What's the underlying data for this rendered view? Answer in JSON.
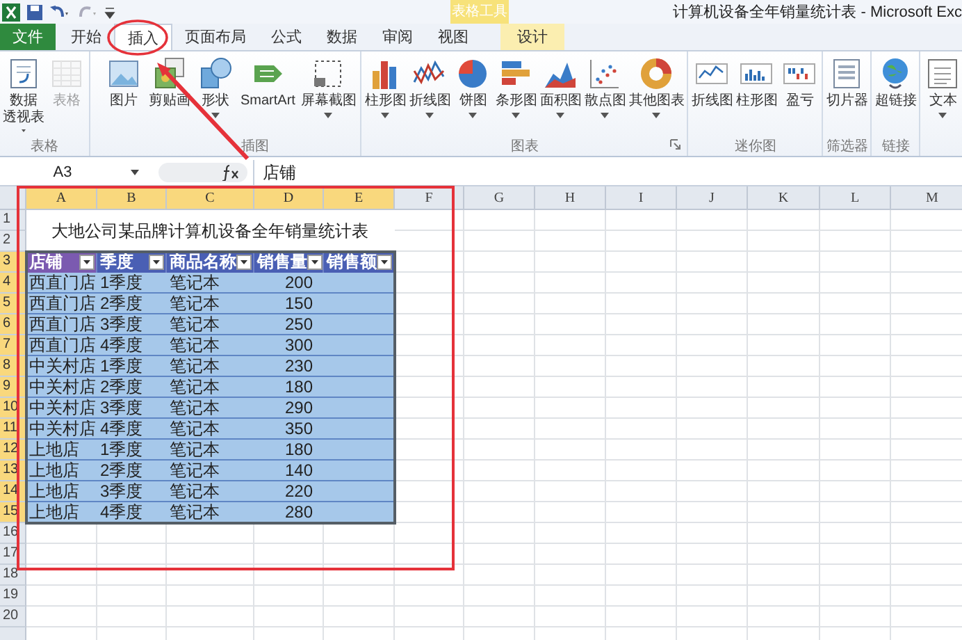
{
  "title_bar": {
    "title": "计算机设备全年销量统计表 - Microsoft Exc",
    "contextual_group": "表格工具"
  },
  "tabs": [
    {
      "label": "文件",
      "kind": "file",
      "selected": false
    },
    {
      "label": "开始",
      "kind": "main",
      "selected": false
    },
    {
      "label": "插入",
      "kind": "main",
      "selected": true
    },
    {
      "label": "页面布局",
      "kind": "main",
      "selected": false
    },
    {
      "label": "公式",
      "kind": "main",
      "selected": false
    },
    {
      "label": "数据",
      "kind": "main",
      "selected": false
    },
    {
      "label": "审阅",
      "kind": "main",
      "selected": false
    },
    {
      "label": "视图",
      "kind": "main",
      "selected": false
    },
    {
      "label": "设计",
      "kind": "contextual",
      "selected": false
    }
  ],
  "ribbon": {
    "groups": [
      {
        "label": "表格",
        "launcher": false,
        "buttons": [
          {
            "lines": [
              "数据",
              "透视表"
            ],
            "dropdown": true,
            "disabled": false
          },
          {
            "label": "表格",
            "dropdown": false,
            "disabled": true
          }
        ]
      },
      {
        "label": "插图",
        "launcher": false,
        "buttons": [
          {
            "label": "图片",
            "dropdown": false,
            "disabled": false
          },
          {
            "label": "剪贴画",
            "dropdown": false,
            "disabled": false
          },
          {
            "label": "形状",
            "dropdown": true,
            "disabled": false
          },
          {
            "label": "SmartArt",
            "dropdown": false,
            "disabled": false
          },
          {
            "label": "屏幕截图",
            "dropdown": true,
            "disabled": false
          }
        ]
      },
      {
        "label": "图表",
        "launcher": true,
        "buttons": [
          {
            "label": "柱形图",
            "dropdown": true,
            "disabled": false
          },
          {
            "label": "折线图",
            "dropdown": true,
            "disabled": false
          },
          {
            "label": "饼图",
            "dropdown": true,
            "disabled": false
          },
          {
            "label": "条形图",
            "dropdown": true,
            "disabled": false
          },
          {
            "label": "面积图",
            "dropdown": true,
            "disabled": false
          },
          {
            "label": "散点图",
            "dropdown": true,
            "disabled": false
          },
          {
            "label": "其他图表",
            "dropdown": true,
            "disabled": false
          }
        ]
      },
      {
        "label": "迷你图",
        "launcher": false,
        "buttons": [
          {
            "label": "折线图",
            "dropdown": false,
            "disabled": false
          },
          {
            "label": "柱形图",
            "dropdown": false,
            "disabled": false
          },
          {
            "label": "盈亏",
            "dropdown": false,
            "disabled": false
          }
        ]
      },
      {
        "label": "筛选器",
        "launcher": false,
        "buttons": [
          {
            "label": "切片器",
            "dropdown": false,
            "disabled": false
          }
        ]
      },
      {
        "label": "链接",
        "launcher": false,
        "buttons": [
          {
            "label": "超链接",
            "dropdown": false,
            "disabled": false
          }
        ]
      },
      {
        "buttons": [
          {
            "label": "文本",
            "dropdown": true,
            "disabled": false
          }
        ]
      }
    ]
  },
  "formula_bar": {
    "name_box": "A3",
    "value": "店铺"
  },
  "sheet": {
    "columns": [
      {
        "label": "A",
        "selected": true
      },
      {
        "label": "B",
        "selected": true
      },
      {
        "label": "C",
        "selected": true
      },
      {
        "label": "D",
        "selected": true
      },
      {
        "label": "E",
        "selected": true
      },
      {
        "label": "F",
        "selected": false
      },
      {
        "label": "G",
        "selected": false
      },
      {
        "label": "H",
        "selected": false
      },
      {
        "label": "I",
        "selected": false
      },
      {
        "label": "J",
        "selected": false
      },
      {
        "label": "K",
        "selected": false
      },
      {
        "label": "L",
        "selected": false
      },
      {
        "label": "M",
        "selected": false
      }
    ],
    "rows": [
      {
        "label": "1",
        "selected": false
      },
      {
        "label": "2",
        "selected": false
      },
      {
        "label": "3",
        "selected": true
      },
      {
        "label": "4",
        "selected": true
      },
      {
        "label": "5",
        "selected": true
      },
      {
        "label": "6",
        "selected": true
      },
      {
        "label": "7",
        "selected": true
      },
      {
        "label": "8",
        "selected": true
      },
      {
        "label": "9",
        "selected": true
      },
      {
        "label": "10",
        "selected": true
      },
      {
        "label": "11",
        "selected": true
      },
      {
        "label": "12",
        "selected": true
      },
      {
        "label": "13",
        "selected": true
      },
      {
        "label": "14",
        "selected": true
      },
      {
        "label": "15",
        "selected": true
      },
      {
        "label": "16",
        "selected": false
      },
      {
        "label": "17",
        "selected": false
      },
      {
        "label": "18",
        "selected": false
      },
      {
        "label": "19",
        "selected": false
      },
      {
        "label": "20",
        "selected": false
      }
    ],
    "title": "大地公司某品牌计算机设备全年销量统计表",
    "table": {
      "headers": [
        {
          "label": "店铺",
          "selected": true
        },
        {
          "label": "季度",
          "selected": false
        },
        {
          "label": "商品名称",
          "selected": false
        },
        {
          "label": "销售量",
          "selected": false
        },
        {
          "label": "销售额",
          "selected": false
        }
      ],
      "rows": [
        [
          "西直门店",
          "1季度",
          "笔记本",
          "200"
        ],
        [
          "西直门店",
          "2季度",
          "笔记本",
          "150"
        ],
        [
          "西直门店",
          "3季度",
          "笔记本",
          "250"
        ],
        [
          "西直门店",
          "4季度",
          "笔记本",
          "300"
        ],
        [
          "中关村店",
          "1季度",
          "笔记本",
          "230"
        ],
        [
          "中关村店",
          "2季度",
          "笔记本",
          "180"
        ],
        [
          "中关村店",
          "3季度",
          "笔记本",
          "290"
        ],
        [
          "中关村店",
          "4季度",
          "笔记本",
          "350"
        ],
        [
          "上地店",
          "1季度",
          "笔记本",
          "180"
        ],
        [
          "上地店",
          "2季度",
          "笔记本",
          "140"
        ],
        [
          "上地店",
          "3季度",
          "笔记本",
          "220"
        ],
        [
          "上地店",
          "4季度",
          "笔记本",
          "280"
        ]
      ]
    }
  },
  "markup": [
    {
      "kind": "ellipse"
    },
    {
      "kind": "arrow"
    },
    {
      "kind": "frame"
    }
  ]
}
